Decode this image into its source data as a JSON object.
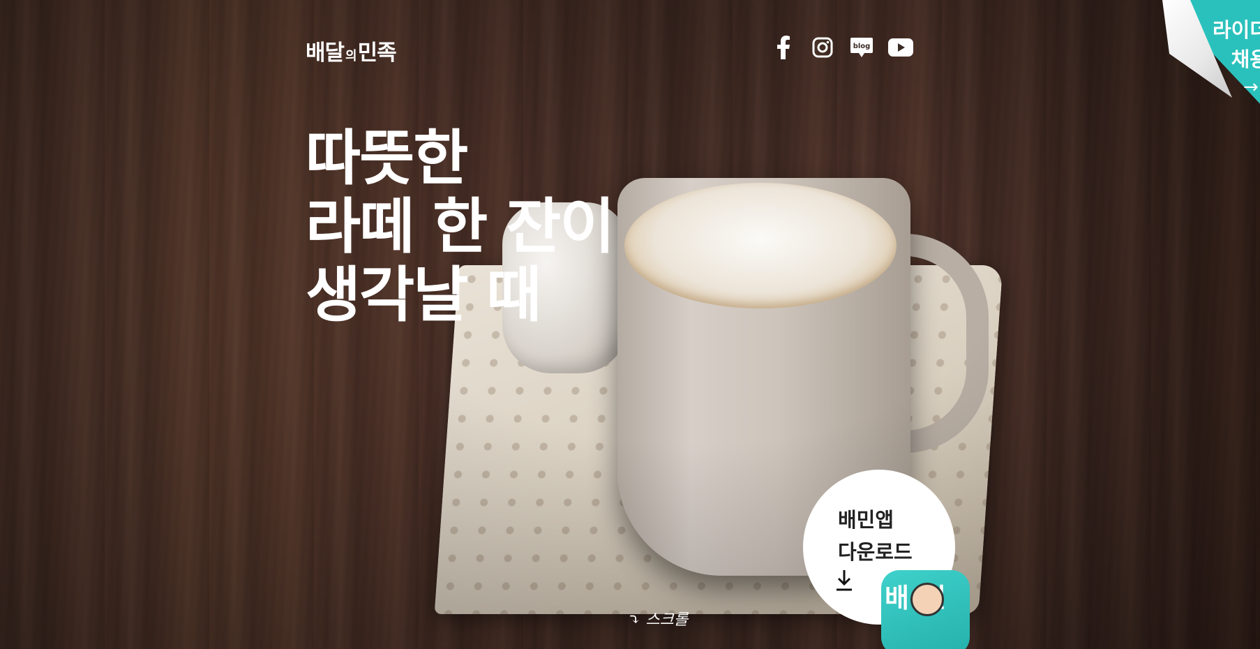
{
  "header": {
    "logo_main": "배달",
    "logo_small": "의",
    "logo_end": "민족",
    "social": [
      {
        "name": "facebook-icon"
      },
      {
        "name": "instagram-icon"
      },
      {
        "name": "blog-icon",
        "label": "blog"
      },
      {
        "name": "youtube-icon"
      }
    ]
  },
  "hero": {
    "lines": [
      "따뜻한",
      "라떼 한 잔이",
      "생각날 때"
    ]
  },
  "rider_banner": {
    "line1": "라이더",
    "line2": "채용"
  },
  "download": {
    "line1": "배민앱",
    "line2": "다운로드",
    "app_icon_text": "배민"
  },
  "scroll_hint": "스크롤",
  "colors": {
    "brand_mint": "#2ac1bc",
    "text_white": "#ffffff",
    "text_dark": "#222222"
  }
}
